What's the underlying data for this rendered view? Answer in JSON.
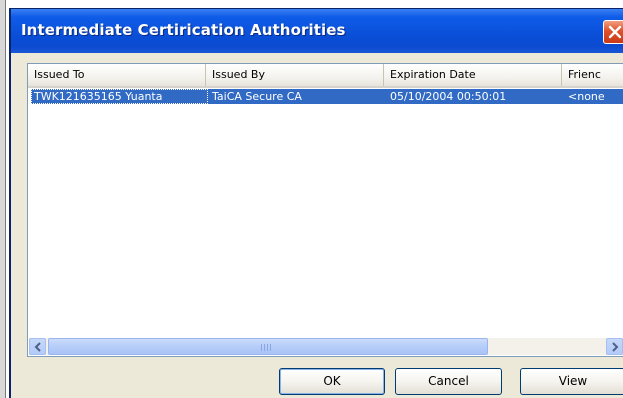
{
  "dialog": {
    "title": "Intermediate Certirication Authorities"
  },
  "list": {
    "columns": [
      "Issued To",
      "Issued By",
      "Expiration Date",
      "Frienc"
    ],
    "rows": [
      {
        "issued_to": "TWK121635165 Yuanta",
        "issued_by": "TaiCA Secure CA",
        "expiration_date": "05/10/2004 00:50:01",
        "friendly_name": "<none"
      }
    ]
  },
  "buttons": {
    "ok": "OK",
    "cancel": "Cancel",
    "view": "View"
  },
  "icons": {
    "close": "close-icon",
    "scroll_left": "arrow-left-icon",
    "scroll_right": "arrow-right-icon"
  },
  "colors": {
    "titlebar": "#0a4fd8",
    "selection": "#316ac5",
    "close_button": "#e0502a"
  }
}
